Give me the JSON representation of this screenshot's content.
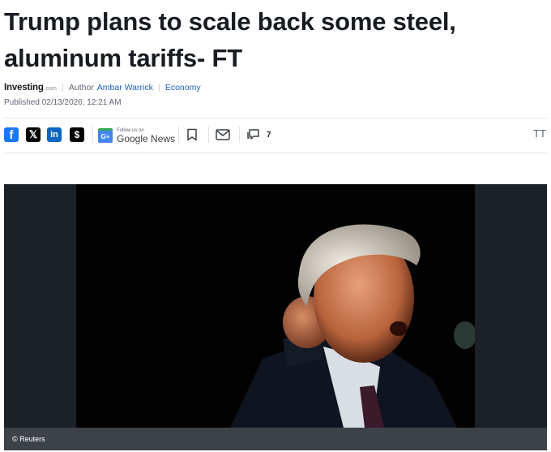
{
  "article": {
    "headline": "Trump plans to scale back some steel, aluminum tariffs- FT",
    "brand": "Investing",
    "brand_suffix": ".com",
    "author_label": "Author",
    "author_name": "Ambar Warrick",
    "category": "Economy",
    "published": "Published 02/13/2026, 12:21 AM"
  },
  "share": {
    "facebook_icon": "f",
    "x_icon": "𝕏",
    "linkedin_icon": "in",
    "substack_icon": "$",
    "google_news_follow": "Follow us on",
    "google_news_name": "Google News",
    "google_news_badge": "G≡",
    "comment_count": "7",
    "text_size_icon": "TT"
  },
  "photo": {
    "caption": "© Reuters"
  },
  "colors": {
    "facebook": "#1877f2",
    "linkedin": "#0a66c2",
    "link": "#1a5ec2",
    "caption_bar": "#3d4249"
  }
}
